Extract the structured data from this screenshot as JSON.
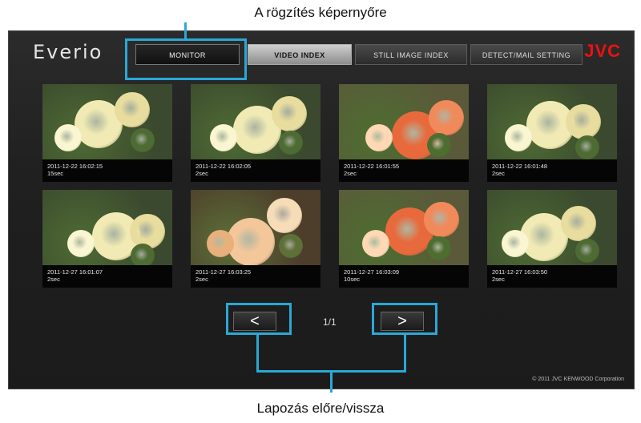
{
  "annotations": {
    "top": "A rögzítés képernyőre",
    "bottom": "Lapozás előre/vissza"
  },
  "header": {
    "brand": "Everio",
    "logo": "JVC",
    "tabs": [
      {
        "label": "MONITOR"
      },
      {
        "label": "VIDEO INDEX"
      },
      {
        "label": "STILL IMAGE INDEX"
      },
      {
        "label": "DETECT/MAIL SETTING"
      }
    ]
  },
  "thumbnails": [
    {
      "datetime": "2011-12-22 16:02:15",
      "duration": "15sec",
      "palette": "cream"
    },
    {
      "datetime": "2011-12-22 16:02:05",
      "duration": "2sec",
      "palette": "cream"
    },
    {
      "datetime": "2011-12-22 16:01:55",
      "duration": "2sec",
      "palette": "coral"
    },
    {
      "datetime": "2011-12-22 16:01:48",
      "duration": "2sec",
      "palette": "cream"
    },
    {
      "datetime": "2011-12-27 16:01:07",
      "duration": "2sec",
      "palette": "cream"
    },
    {
      "datetime": "2011-12-27 16:03:25",
      "duration": "2sec",
      "palette": "peach"
    },
    {
      "datetime": "2011-12-27 16:03:09",
      "duration": "10sec",
      "palette": "coral"
    },
    {
      "datetime": "2011-12-27 16:03:50",
      "duration": "2sec",
      "palette": "cream"
    }
  ],
  "pager": {
    "prev_label": "<",
    "next_label": ">",
    "page": "1/1"
  },
  "footer": {
    "copyright": "© 2011 JVC KENWOOD Corporation"
  },
  "colors": {
    "highlight": "#2aa8d6",
    "logo": "#e11111"
  }
}
